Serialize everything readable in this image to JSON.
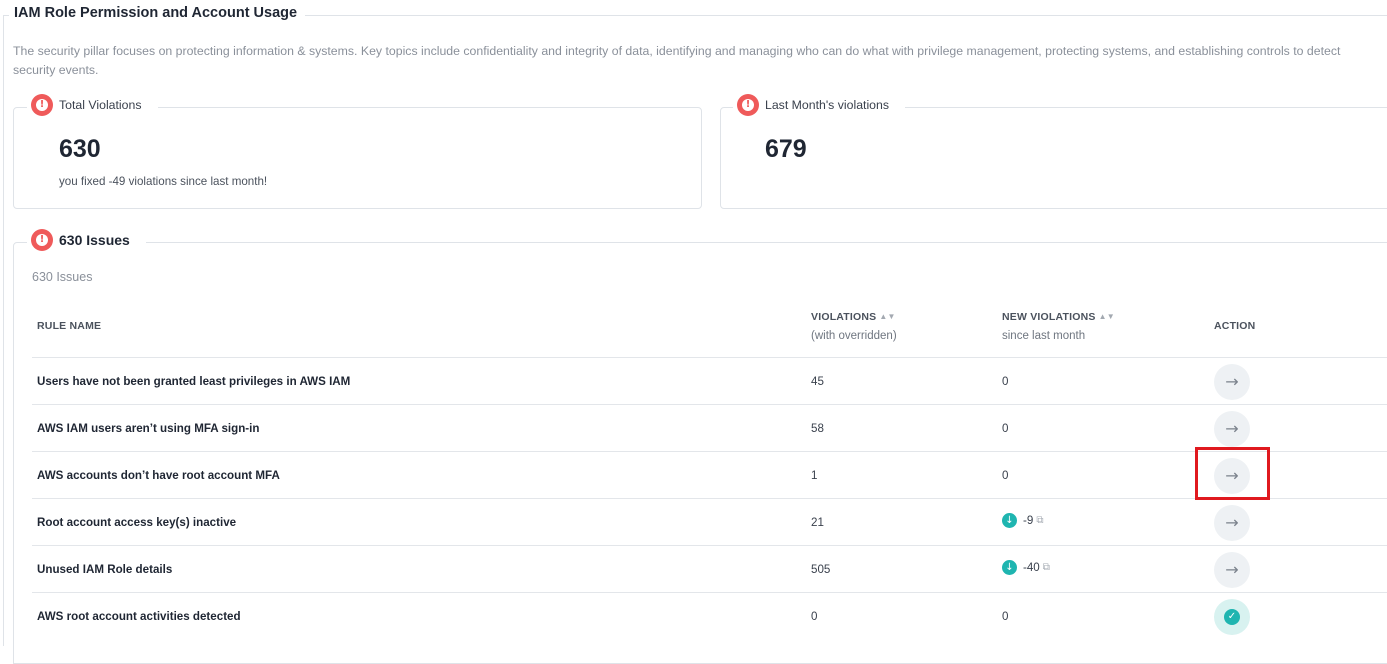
{
  "section": {
    "title": "IAM Role Permission and Account Usage",
    "description": "The security pillar focuses on protecting information & systems. Key topics include confidentiality and integrity of data, identifying and managing who can do what with privilege management, protecting systems, and establishing controls to detect security events."
  },
  "cards": {
    "total": {
      "label": "Total Violations",
      "value": "630",
      "sub": "you fixed -49 violations since last month!"
    },
    "last_month": {
      "label": "Last Month's violations",
      "value": "679"
    }
  },
  "issues": {
    "legend": "630 Issues",
    "subtitle": "630 Issues",
    "columns": {
      "rule_name": "RULE NAME",
      "violations": "VIOLATIONS",
      "violations_sub": "(with overridden)",
      "new_violations": "NEW VIOLATIONS",
      "new_violations_sub": "since last month",
      "action": "ACTION"
    },
    "rows": [
      {
        "name": "Users have not been granted least privileges in AWS IAM",
        "violations": "45",
        "new": "0",
        "new_type": "plain",
        "action": "arrow"
      },
      {
        "name": "AWS IAM users aren’t using MFA sign-in",
        "violations": "58",
        "new": "0",
        "new_type": "plain",
        "action": "arrow"
      },
      {
        "name": "AWS accounts don’t have root account MFA",
        "violations": "1",
        "new": "0",
        "new_type": "plain",
        "action": "arrow"
      },
      {
        "name": "Root account access key(s) inactive",
        "violations": "21",
        "new": "-9",
        "new_type": "down",
        "action": "arrow"
      },
      {
        "name": "Unused IAM Role details",
        "violations": "505",
        "new": "-40",
        "new_type": "down",
        "action": "arrow"
      },
      {
        "name": "AWS root account activities detected",
        "violations": "0",
        "new": "0",
        "new_type": "plain",
        "action": "check"
      }
    ]
  },
  "glyphs": {
    "alert": "!",
    "sort": "▲▼",
    "arrow": "→",
    "down": "↓",
    "external": "⧉",
    "check": "✓"
  },
  "colors": {
    "alert": "#ef5a5a",
    "teal": "#1fb5b0",
    "highlight": "#e0191f"
  }
}
